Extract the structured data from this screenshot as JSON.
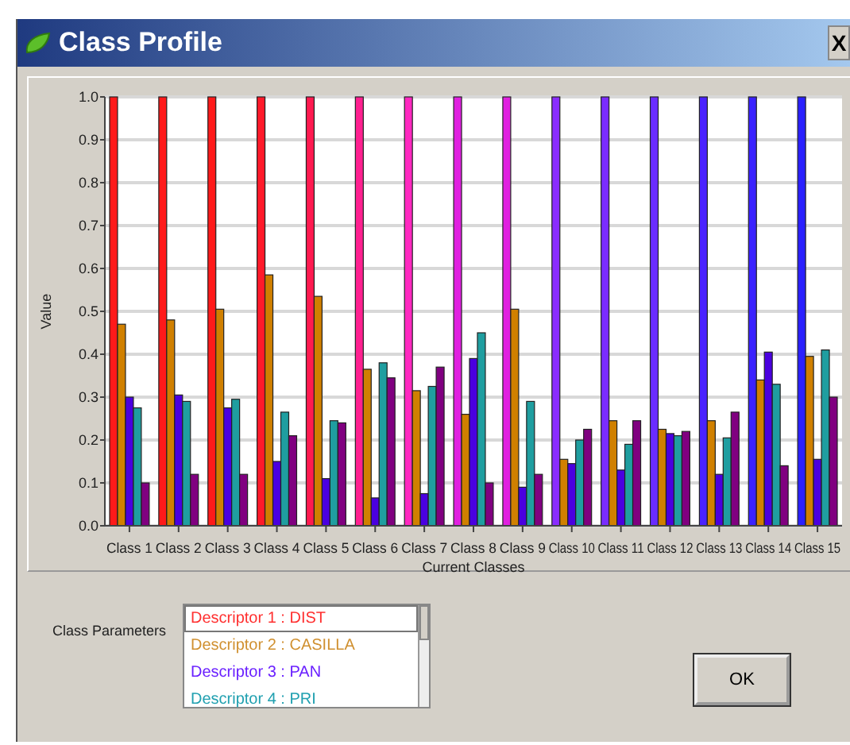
{
  "window": {
    "title": "Class Profile",
    "close": "X"
  },
  "chart": {
    "chart_data": {
      "type": "bar",
      "grid": true,
      "xlabel": "Current Classes",
      "ylabel": "Value",
      "categories": [
        "Class 1",
        "Class 2",
        "Class 3",
        "Class 4",
        "Class 5",
        "Class 6",
        "Class 7",
        "Class 8",
        "Class 9",
        "Class 10",
        "Class 11",
        "Class 12",
        "Class 13",
        "Class 14",
        "Class 15"
      ],
      "ylim": [
        0,
        1
      ],
      "yticks": [
        {
          "value": 0,
          "label": "0.0"
        },
        {
          "value": 0.1,
          "label": "0.1"
        },
        {
          "value": 0.2,
          "label": "0.2"
        },
        {
          "value": 0.3,
          "label": "0.3"
        },
        {
          "value": 0.4,
          "label": "0.4"
        },
        {
          "value": 0.5,
          "label": "0.5"
        },
        {
          "value": 0.6,
          "label": "0.6"
        },
        {
          "value": 0.7,
          "label": "0.7"
        },
        {
          "value": 0.8,
          "label": "0.8"
        },
        {
          "value": 0.9,
          "label": "0.9"
        },
        {
          "value": 1,
          "label": "1.0"
        }
      ],
      "series": [
        {
          "colors": [
            "#ff1a1a",
            "#ff1a1a",
            "#ff1a1a",
            "#ff1a2a",
            "#ff1a50",
            "#ff2090",
            "#ff28c0",
            "#e020e0",
            "#e020e0",
            "#8a2cff",
            "#7a2cff",
            "#6a2cff",
            "#4a22ff",
            "#3a22ff",
            "#2a20ff"
          ],
          "values": [
            1,
            1,
            1,
            1,
            1,
            1,
            1,
            1,
            1,
            1,
            1,
            1,
            1,
            1,
            1
          ]
        },
        {
          "color": "#d08000",
          "values": [
            0.47,
            0.48,
            0.505,
            0.585,
            0.535,
            0.365,
            0.315,
            0.26,
            0.505,
            0.155,
            0.245,
            0.225,
            0.245,
            0.34,
            0.395
          ]
        },
        {
          "color": "#4a00e0",
          "values": [
            0.3,
            0.305,
            0.275,
            0.15,
            0.11,
            0.065,
            0.075,
            0.39,
            0.09,
            0.145,
            0.13,
            0.215,
            0.12,
            0.405,
            0.155
          ]
        },
        {
          "color": "#1f9ea0",
          "values": [
            0.275,
            0.29,
            0.295,
            0.265,
            0.245,
            0.38,
            0.325,
            0.45,
            0.29,
            0.2,
            0.19,
            0.21,
            0.205,
            0.33,
            0.41
          ]
        },
        {
          "color": "#800080",
          "values": [
            0.1,
            0.12,
            0.12,
            0.21,
            0.24,
            0.345,
            0.37,
            0.1,
            0.12,
            0.225,
            0.245,
            0.22,
            0.265,
            0.14,
            0.3
          ]
        }
      ]
    }
  },
  "class_parameters": {
    "label": "Class Parameters",
    "items": [
      {
        "text": "Descriptor 1 : DIST",
        "color": "#ff3030",
        "selected": true
      },
      {
        "text": "Descriptor 2 : CASILLA",
        "color": "#d09030",
        "selected": false
      },
      {
        "text": "Descriptor 3 : PAN",
        "color": "#6a20ff",
        "selected": false
      },
      {
        "text": "Descriptor 4 : PRI",
        "color": "#20a0b0",
        "selected": false
      }
    ]
  },
  "buttons": [
    {
      "label": "OK"
    }
  ]
}
